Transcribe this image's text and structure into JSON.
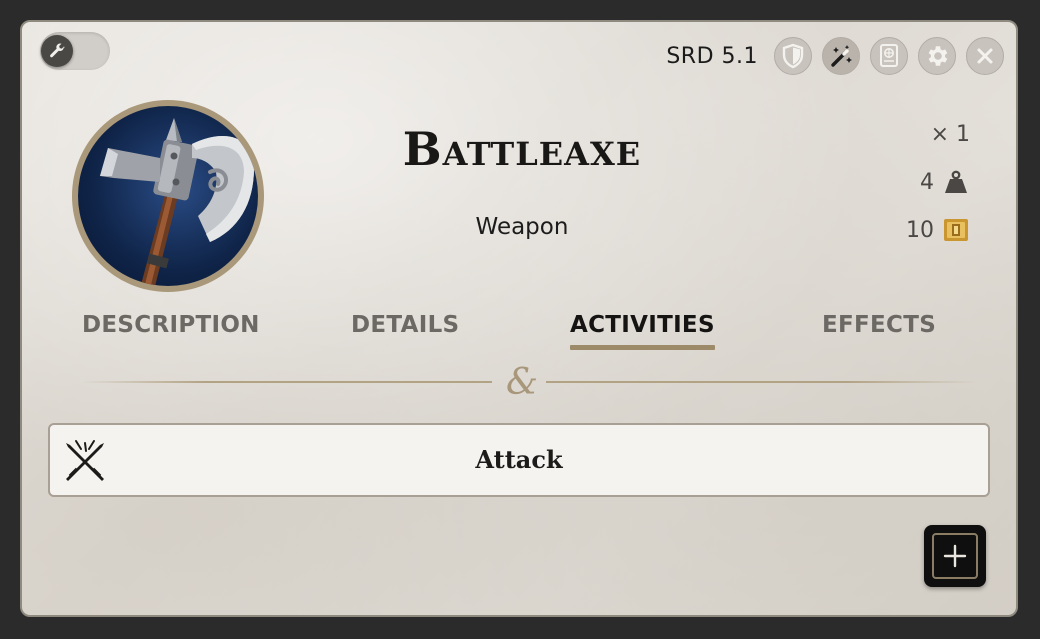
{
  "header": {
    "source_label": "SRD 5.1",
    "controls": [
      {
        "name": "shield-icon"
      },
      {
        "name": "magic-wand-icon"
      },
      {
        "name": "compendium-icon"
      },
      {
        "name": "gear-icon"
      },
      {
        "name": "close-icon"
      }
    ],
    "mode_toggle_icon": "wrench-icon"
  },
  "item": {
    "name": "Battleaxe",
    "type": "Weapon",
    "portrait_icon": "battleaxe-icon",
    "quantity": "× 1",
    "weight": "4",
    "weight_icon": "weight-icon",
    "price": "10",
    "price_icon": "gold-coin-icon"
  },
  "tabs": [
    {
      "label": "DESCRIPTION",
      "active": false
    },
    {
      "label": "DETAILS",
      "active": false
    },
    {
      "label": "ACTIVITIES",
      "active": true
    },
    {
      "label": "EFFECTS",
      "active": false
    }
  ],
  "divider_glyph": "&",
  "activities": [
    {
      "name": "Attack",
      "icon": "crossed-swords-icon"
    }
  ],
  "add_button_icon": "plus-icon",
  "colors": {
    "accent": "#9c8a68",
    "panel": "#e0dcd6",
    "activity_bg": "#f5f3f0"
  }
}
